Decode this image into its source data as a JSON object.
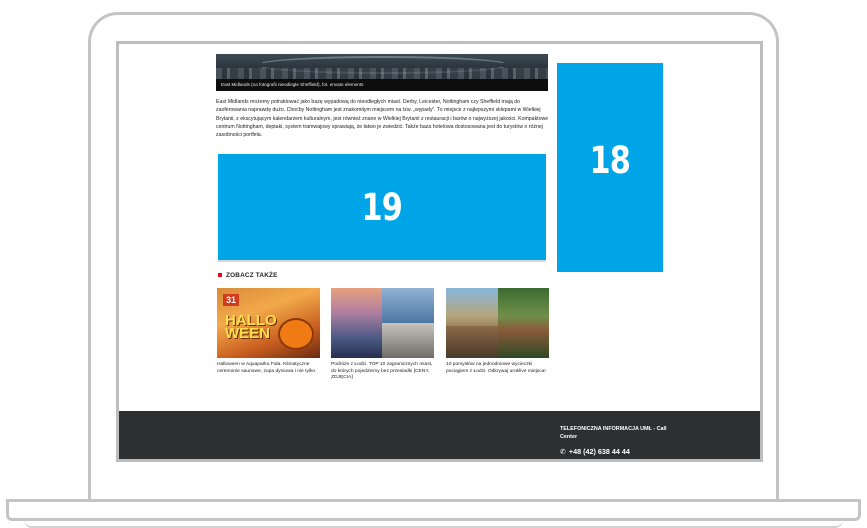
{
  "hero": {
    "caption": "East Midlands (na fotografii nieodległe Sheffield), fot. envato elements"
  },
  "article": {
    "text": "East Midlands możemy potraktować jako bazę wypadową do nieodległych miast. Derby, Leicester, Nottingham czy Sheffield mają do zaoferowania naprawdę dużo. Choćby Nottingham jest znakomitym miejscem na tzw. „wypady”. To miejsce z najlepszymi sklepami w Wielkiej Brytanii, z ekscytującym kalendarzem kulturalnym, jest również znane w Wielkiej Brytanii z restauracji i barów o najwyższej jakości. Kompaktowe centrum Nottingham, deptaki, system tramwajowy sprawiają, że łatwo je zwiedzić. Także baza hotelowa dostosowana jest do turystów o różnej zasobności portfela."
  },
  "ads": {
    "main_label": "19",
    "side_label": "18",
    "color": "#00a5e8"
  },
  "related": {
    "title": "ZOBACZ TAKŻE",
    "items": [
      {
        "thumb_text_badge": "31",
        "thumb_text_main": "HALLO WEEN",
        "caption": "Halloween w Aquaparku Fala. Klimatyczne ceremonie saunowe, zupa dyniowa i nie tylko"
      },
      {
        "caption": "Podróże z Łodzi. TOP 10 zagranicznych miast, do których pojedziemy bez przesiadki [CENY, ZDJĘCIA]"
      },
      {
        "caption": "10 pomysłów na jednodniowe wycieczki pociągiem z Łodzi. Odkrywaj uroklive miejsca!"
      }
    ]
  },
  "footer": {
    "label": "TELEFONICZNA INFORMACJA UMŁ - Call Center",
    "phone": "+48 (42) 638 44 44",
    "phone_icon": "phone-icon"
  }
}
